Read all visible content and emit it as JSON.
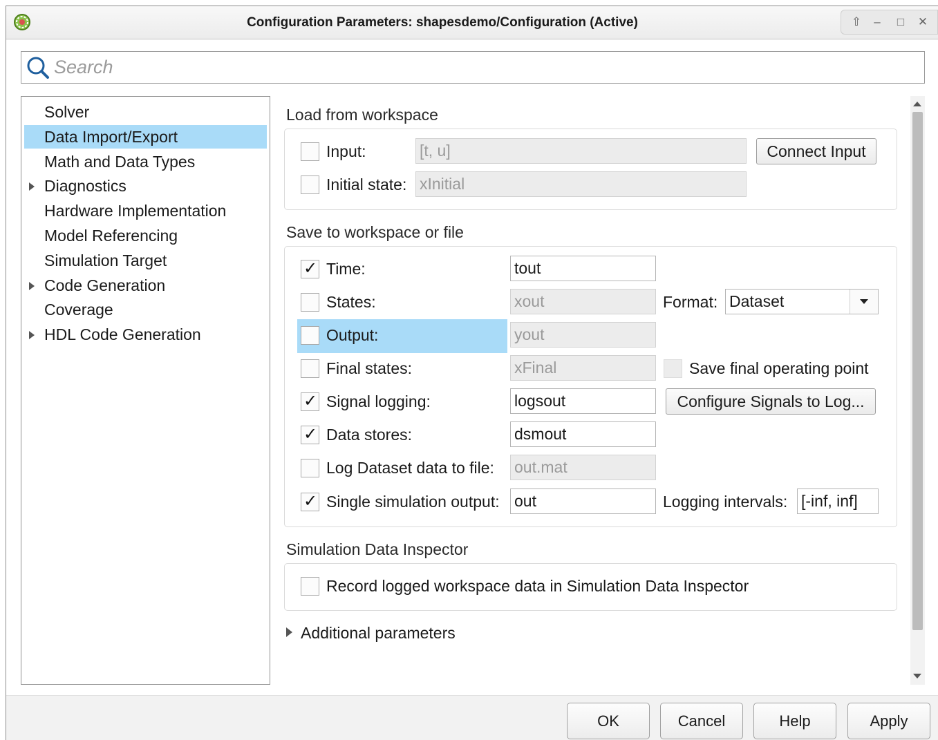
{
  "window": {
    "title": "Configuration Parameters: shapesdemo/Configuration (Active)",
    "controls": {
      "pin": "⇧",
      "minimize": "–",
      "maximize": "□",
      "close": "✕"
    }
  },
  "search": {
    "placeholder": "Search",
    "value": ""
  },
  "tree": {
    "items": [
      {
        "label": "Solver",
        "expandable": false,
        "selected": false
      },
      {
        "label": "Data Import/Export",
        "expandable": false,
        "selected": true
      },
      {
        "label": "Math and Data Types",
        "expandable": false,
        "selected": false
      },
      {
        "label": "Diagnostics",
        "expandable": true,
        "selected": false
      },
      {
        "label": "Hardware Implementation",
        "expandable": false,
        "selected": false
      },
      {
        "label": "Model Referencing",
        "expandable": false,
        "selected": false
      },
      {
        "label": "Simulation Target",
        "expandable": false,
        "selected": false
      },
      {
        "label": "Code Generation",
        "expandable": true,
        "selected": false
      },
      {
        "label": "Coverage",
        "expandable": false,
        "selected": false
      },
      {
        "label": "HDL Code Generation",
        "expandable": true,
        "selected": false
      }
    ]
  },
  "load": {
    "title": "Load from workspace",
    "input": {
      "label": "Input:",
      "checked": false,
      "value": "[t, u]"
    },
    "initial_state": {
      "label": "Initial state:",
      "checked": false,
      "value": "xInitial"
    },
    "connect_button": "Connect Input"
  },
  "save": {
    "title": "Save to workspace or file",
    "time": {
      "label": "Time:",
      "checked": true,
      "value": "tout"
    },
    "states": {
      "label": "States:",
      "checked": false,
      "value": "xout"
    },
    "format": {
      "label": "Format:",
      "value": "Dataset"
    },
    "output": {
      "label": "Output:",
      "checked": false,
      "value": "yout"
    },
    "final_states": {
      "label": "Final states:",
      "checked": false,
      "value": "xFinal"
    },
    "save_final_op": {
      "label": "Save final operating point",
      "checked": false
    },
    "signal_logging": {
      "label": "Signal logging:",
      "checked": true,
      "value": "logsout"
    },
    "configure_signals_button": "Configure Signals to Log...",
    "data_stores": {
      "label": "Data stores:",
      "checked": true,
      "value": "dsmout"
    },
    "log_dataset": {
      "label": "Log Dataset data to file:",
      "checked": false,
      "value": "out.mat"
    },
    "single_output": {
      "label": "Single simulation output:",
      "checked": true,
      "value": "out"
    },
    "logging_intervals": {
      "label": "Logging intervals:",
      "value": "[-inf, inf]"
    }
  },
  "sdi": {
    "title": "Simulation Data Inspector",
    "record": {
      "label": "Record logged workspace data in Simulation Data Inspector",
      "checked": false
    }
  },
  "additional": {
    "label": "Additional parameters"
  },
  "footer": {
    "ok": "OK",
    "cancel": "Cancel",
    "help": "Help",
    "apply": "Apply"
  },
  "colors": {
    "selection": "#a9dbf8",
    "disabled_field": "#ececec"
  }
}
